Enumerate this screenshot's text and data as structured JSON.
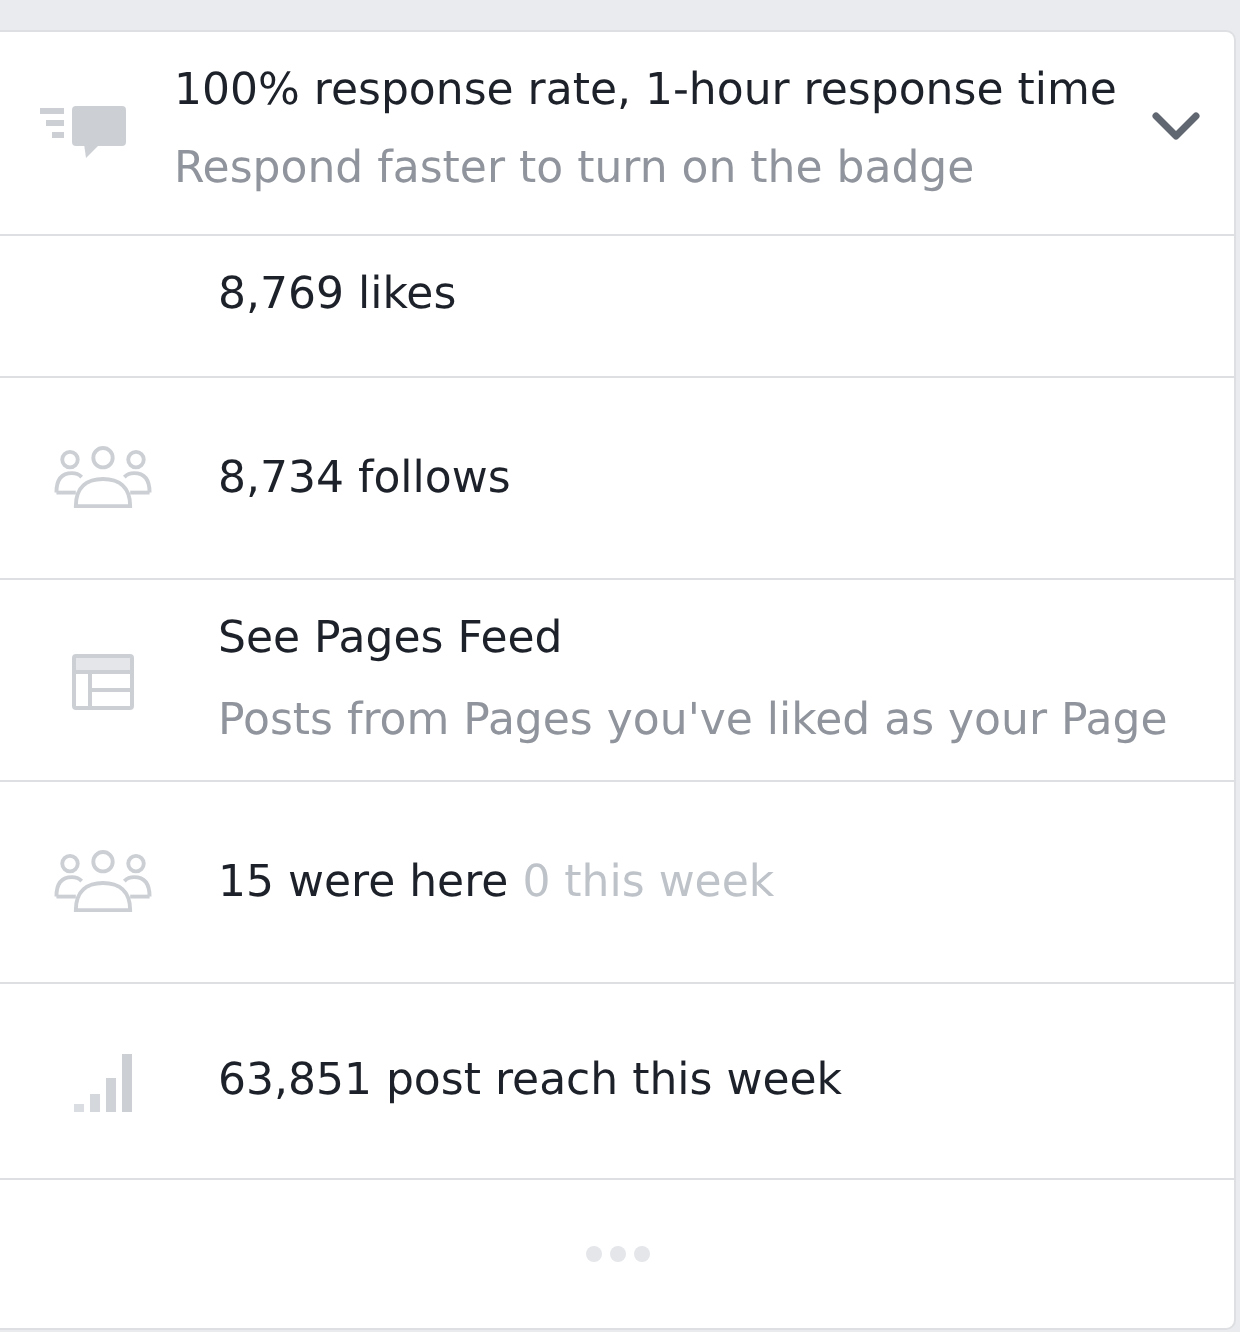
{
  "card": {
    "response": {
      "title": "100% response rate, 1-hour response time",
      "subtitle": "Respond faster to turn on the badge",
      "expanded": false
    },
    "items": [
      {
        "kind": "likes",
        "text": "8,769 likes"
      },
      {
        "kind": "follows",
        "text": "8,734 follows"
      },
      {
        "kind": "feed",
        "text": "See Pages Feed",
        "subtitle": "Posts from Pages you've liked as your Page"
      },
      {
        "kind": "checkins",
        "text": "15 were here",
        "note": "0 this week"
      },
      {
        "kind": "reach",
        "text": "63,851 post reach this week"
      }
    ]
  }
}
